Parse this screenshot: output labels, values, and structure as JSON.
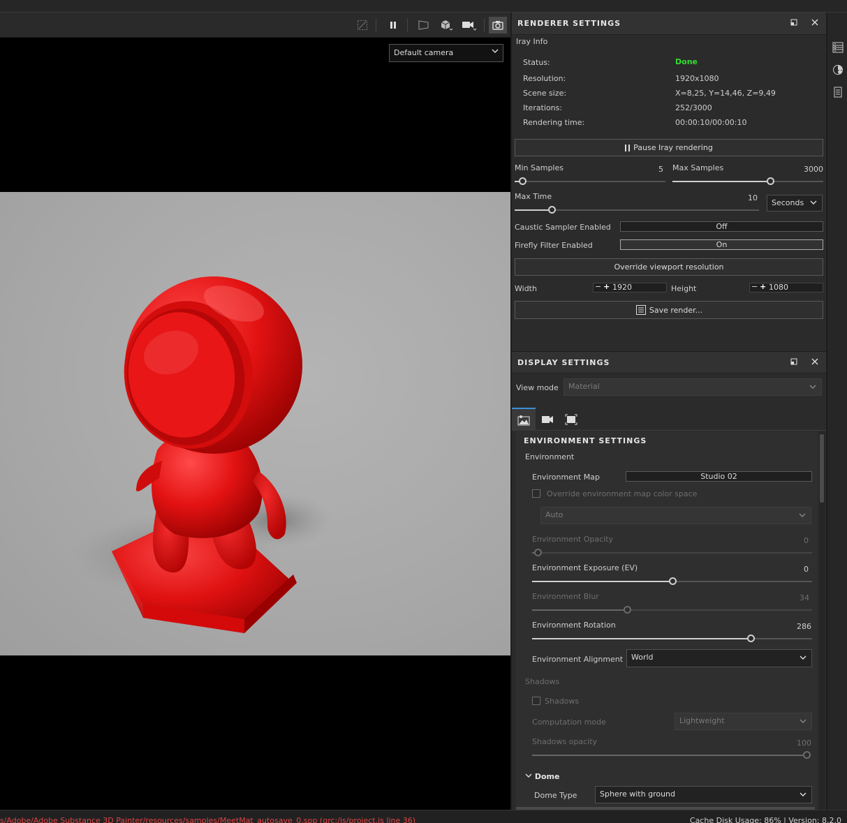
{
  "viewport": {
    "camera_select": "Default camera",
    "chevron": "⌄"
  },
  "renderer": {
    "title": "RENDERER SETTINGS",
    "iray_info_label": "Iray Info",
    "status_label": "Status:",
    "status_value": "Done",
    "resolution_label": "Resolution:",
    "resolution_value": "1920x1080",
    "scene_size_label": "Scene size:",
    "scene_size_value": "X=8,25, Y=14,46, Z=9,49",
    "iterations_label": "Iterations:",
    "iterations_value": "252/3000",
    "rendering_time_label": "Rendering time:",
    "rendering_time_value": "00:00:10/00:00:10",
    "pause_button": "Pause Iray rendering",
    "min_samples_label": "Min Samples",
    "min_samples_value": "5",
    "min_samples_fraction": 0.05,
    "max_samples_label": "Max Samples",
    "max_samples_value": "3000",
    "max_samples_fraction": 0.65,
    "max_time_label": "Max Time",
    "max_time_value": "10",
    "max_time_fraction": 0.15,
    "time_unit_select": "Seconds",
    "caustic_label": "Caustic Sampler Enabled",
    "caustic_value": "Off",
    "firefly_label": "Firefly Filter Enabled",
    "firefly_value": "On",
    "override_button": "Override viewport resolution",
    "width_label": "Width",
    "width_value": "1920",
    "height_label": "Height",
    "height_value": "1080",
    "save_button": "Save render..."
  },
  "display": {
    "title": "DISPLAY SETTINGS",
    "view_mode_label": "View mode",
    "view_mode_value": "Material",
    "env": {
      "section_title": "ENVIRONMENT SETTINGS",
      "environment_label": "Environment",
      "env_map_label": "Environment Map",
      "env_map_value": "Studio 02",
      "override_color_space_label": "Override environment map color space",
      "color_space_value": "Auto",
      "opacity_label": "Environment Opacity",
      "opacity_value": "0",
      "opacity_fraction": 0.02,
      "exposure_label": "Environment Exposure (EV)",
      "exposure_value": "0",
      "exposure_fraction": 0.5,
      "blur_label": "Environment Blur",
      "blur_value": "34",
      "blur_fraction": 0.34,
      "rotation_label": "Environment Rotation",
      "rotation_value": "286",
      "rotation_fraction": 0.78,
      "alignment_label": "Environment Alignment",
      "alignment_value": "World",
      "shadows_section": "Shadows",
      "shadows_checkbox_label": "Shadows",
      "computation_mode_label": "Computation mode",
      "computation_mode_value": "Lightweight",
      "shadows_opacity_label": "Shadows opacity",
      "shadows_opacity_value": "100",
      "shadows_opacity_fraction": 1.0,
      "dome_label": "Dome",
      "dome_type_label": "Dome Type",
      "dome_type_value": "Sphere with ground"
    }
  },
  "statusbar": {
    "error_text": "s/Adobe/Adobe Substance 3D Painter/resources/samples/MeetMat_autosave_0.spp (qrc:/js/project.js line 36)",
    "info_text": "Cache Disk Usage:  86% | Version: 8.2.0"
  },
  "colors": {
    "status_done": "#33dd33",
    "tab_accent": "#3d8fd8",
    "error": "#e04444",
    "model_red": "#e31212"
  }
}
